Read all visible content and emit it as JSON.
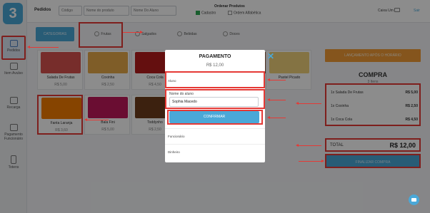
{
  "logo": "3",
  "sidebar": {
    "items": [
      {
        "label": "Pedidos",
        "icon": "cart-icon"
      },
      {
        "label": "Item Avulso",
        "icon": "box-icon"
      },
      {
        "label": "Recarga",
        "icon": "card-icon"
      },
      {
        "label": "Pagamento Funcionário",
        "icon": "wallet-icon"
      },
      {
        "label": "Totens",
        "icon": "kiosk-icon"
      }
    ]
  },
  "header": {
    "title": "Pedidos",
    "code_placeholder": "Código",
    "product_placeholder": "Nome do produto",
    "student_placeholder": "Nome Do Aluno",
    "order_title": "Ordenar Produtos",
    "order_options": [
      {
        "label": "Cadastro",
        "checked": true
      },
      {
        "label": "Ordem Alfabética",
        "checked": false
      }
    ],
    "cashier": "Caixa Um",
    "logout": "Sair"
  },
  "categories": [
    "CATEGORIAS",
    "Frutas",
    "Salgados",
    "Bebidas",
    "Doces"
  ],
  "products": [
    {
      "name": "Salada De Frutas",
      "price": "R$ 5,00",
      "color": "#d9534f"
    },
    {
      "name": "Coxinha",
      "price": "R$ 2,50",
      "color": "#e8a94a"
    },
    {
      "name": "Coca Cola",
      "price": "R$ 4,50",
      "color": "#b71c1c"
    },
    {
      "name": "Misto Quente",
      "price": "R$ 5,00",
      "color": "#d4a35a"
    },
    {
      "name": "Mix De Doces",
      "price": "R$ 2,00",
      "color": "#8e5a3c"
    },
    {
      "name": "Maçã",
      "price": "R$ 2,00",
      "color": "#c62828"
    },
    {
      "name": "Pastel Picado",
      "price": "R$ 3,50",
      "color": "#f0d27a"
    },
    {
      "name": "Fanta Laranja",
      "price": "R$ 3,60",
      "color": "#f57c00"
    },
    {
      "name": "Bala Fini",
      "price": "R$ 5,00",
      "color": "#c2185b"
    },
    {
      "name": "Toddynho",
      "price": "R$ 2,50",
      "color": "#6d3c1d"
    }
  ],
  "right_panel": {
    "launch_button": "LANÇAMENTO APÓS O HORÁRIO",
    "title": "COMPRA",
    "count": "3 Itens",
    "items": [
      {
        "label": "1x Salada De Frutas",
        "price": "R$ 5,00"
      },
      {
        "label": "1x Coxinha",
        "price": "R$ 2,50"
      },
      {
        "label": "1x Coca Cola",
        "price": "R$ 4,50"
      }
    ],
    "total_label": "TOTAL",
    "total_value": "R$ 12,00",
    "finish_button": "FINALIZAR COMPRA"
  },
  "modal": {
    "title": "PAGAMENTO",
    "price": "R$ 12,00",
    "sections": [
      "Aluno",
      "Funcionário",
      "Dinheiro"
    ],
    "student_field_label": "Nome do aluno",
    "student_value": "Sophia Macedo",
    "confirm": "CONFIRMAR",
    "close": "✕"
  }
}
